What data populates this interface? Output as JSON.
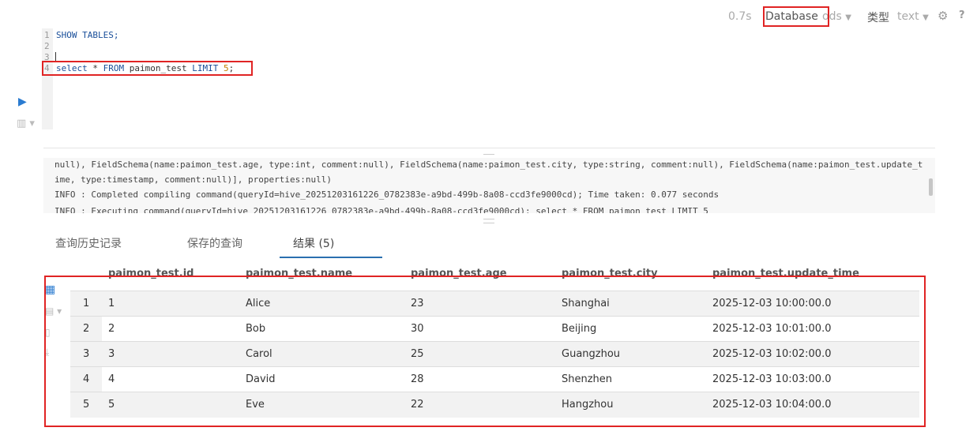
{
  "toolbar": {
    "time": "0.7s",
    "database_label": "Database",
    "database_value": "ods",
    "type_label": "类型",
    "type_value": "text",
    "help": "?"
  },
  "editor": {
    "lines": [
      {
        "no": "1",
        "text": "SHOW TABLES;"
      },
      {
        "no": "2",
        "text": ""
      },
      {
        "no": "3",
        "text": ""
      },
      {
        "no": "4",
        "text": "select * FROM paimon_test LIMIT 5;"
      }
    ]
  },
  "log": {
    "lines": [
      "null), FieldSchema(name:paimon_test.age, type:int, comment:null), FieldSchema(name:paimon_test.city, type:string, comment:null), FieldSchema(name:paimon_test.update_t",
      "ime, type:timestamp, comment:null)], properties:null)",
      "INFO  : Completed compiling command(queryId=hive_20251203161226_0782383e-a9bd-499b-8a08-ccd3fe9000cd); Time taken: 0.077 seconds",
      "INFO  : Executing command(queryId=hive_20251203161226_0782383e-a9bd-499b-8a08-ccd3fe9000cd): select * FROM paimon_test LIMIT 5"
    ]
  },
  "tabs": [
    {
      "label": "查询历史记录"
    },
    {
      "label": "保存的查询"
    },
    {
      "label": "结果 (5)"
    }
  ],
  "table": {
    "headers": [
      "paimon_test.id",
      "paimon_test.name",
      "paimon_test.age",
      "paimon_test.city",
      "paimon_test.update_time"
    ],
    "rows": [
      {
        "n": "1",
        "cells": [
          "1",
          "Alice",
          "23",
          "Shanghai",
          "2025-12-03 10:00:00.0"
        ]
      },
      {
        "n": "2",
        "cells": [
          "2",
          "Bob",
          "30",
          "Beijing",
          "2025-12-03 10:01:00.0"
        ]
      },
      {
        "n": "3",
        "cells": [
          "3",
          "Carol",
          "25",
          "Guangzhou",
          "2025-12-03 10:02:00.0"
        ]
      },
      {
        "n": "4",
        "cells": [
          "4",
          "David",
          "28",
          "Shenzhen",
          "2025-12-03 10:03:00.0"
        ]
      },
      {
        "n": "5",
        "cells": [
          "5",
          "Eve",
          "22",
          "Hangzhou",
          "2025-12-03 10:04:00.0"
        ]
      }
    ]
  },
  "colors": {
    "highlight_border": "#e02424",
    "accent": "#2a6fb0"
  }
}
